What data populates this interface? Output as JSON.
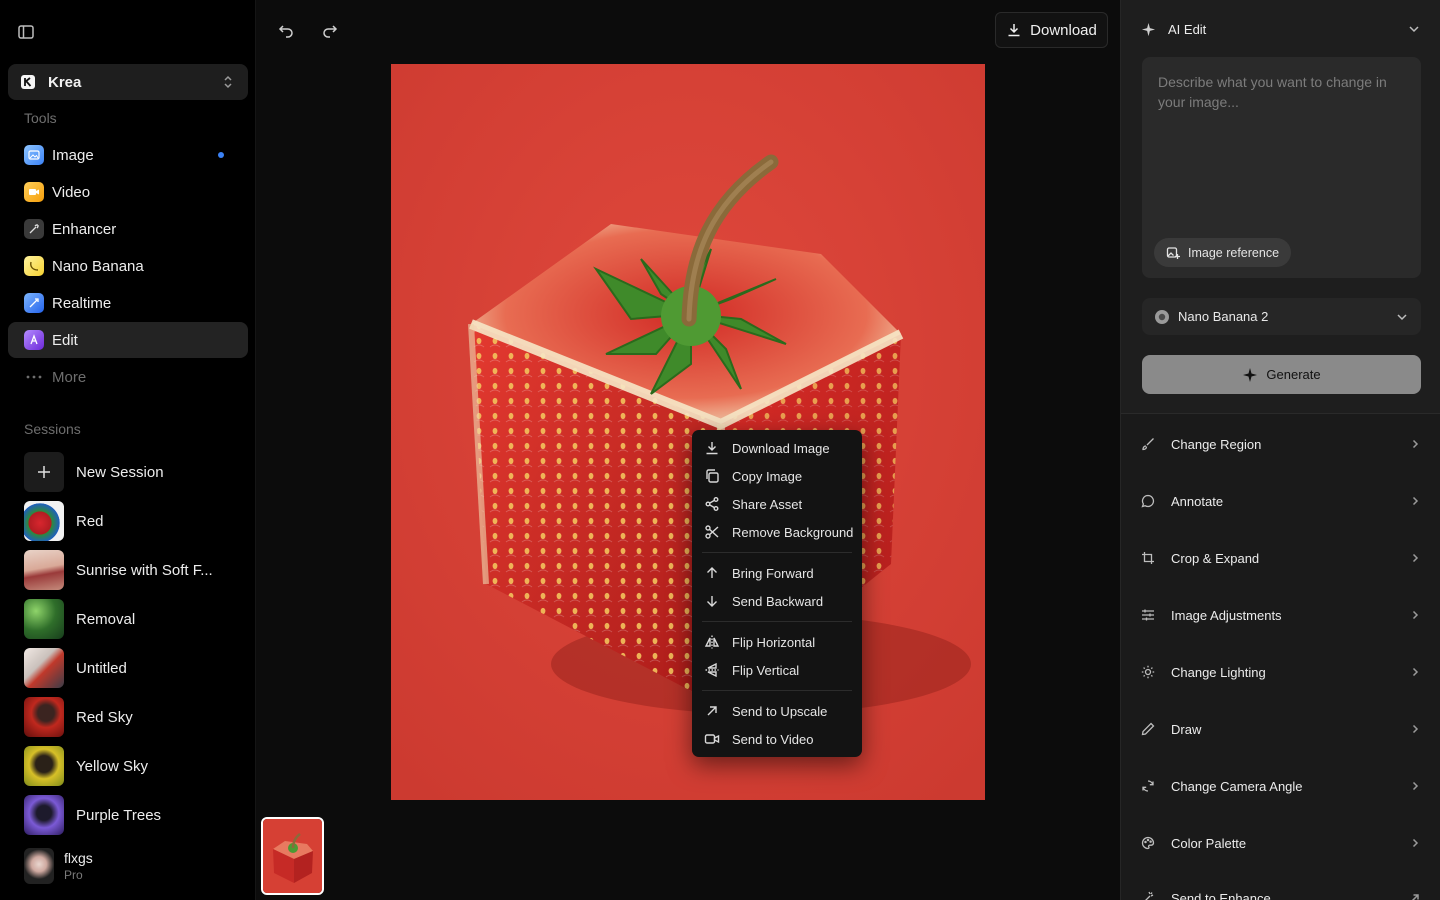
{
  "sidebar": {
    "workspace_name": "Krea",
    "tools_label": "Tools",
    "tools": [
      {
        "label": "Image"
      },
      {
        "label": "Video"
      },
      {
        "label": "Enhancer"
      },
      {
        "label": "Nano Banana"
      },
      {
        "label": "Realtime"
      },
      {
        "label": "Edit"
      },
      {
        "label": "More"
      }
    ],
    "sessions_label": "Sessions",
    "new_session": "New Session",
    "sessions": [
      {
        "label": "Red"
      },
      {
        "label": "Sunrise with Soft F..."
      },
      {
        "label": "Removal"
      },
      {
        "label": "Untitled"
      },
      {
        "label": "Red Sky"
      },
      {
        "label": "Yellow Sky"
      },
      {
        "label": "Purple Trees"
      }
    ],
    "user": {
      "name": "flxgs",
      "plan": "Pro"
    }
  },
  "toolbar": {
    "download_label": "Download"
  },
  "context_menu": {
    "group1": [
      "Download Image",
      "Copy Image",
      "Share Asset",
      "Remove Background"
    ],
    "group2": [
      "Bring Forward",
      "Send Backward"
    ],
    "group3": [
      "Flip Horizontal",
      "Flip Vertical"
    ],
    "group4": [
      "Send to Upscale",
      "Send to Video"
    ]
  },
  "panel": {
    "ai_edit_title": "AI Edit",
    "prompt_placeholder": "Describe what you want to change in your image...",
    "image_reference": "Image reference",
    "model": "Nano Banana 2",
    "generate": "Generate",
    "operations": [
      "Change Region",
      "Annotate",
      "Crop & Expand",
      "Image Adjustments",
      "Change Lighting",
      "Draw",
      "Change Camera Angle",
      "Color Palette",
      "Send to Enhance"
    ]
  }
}
